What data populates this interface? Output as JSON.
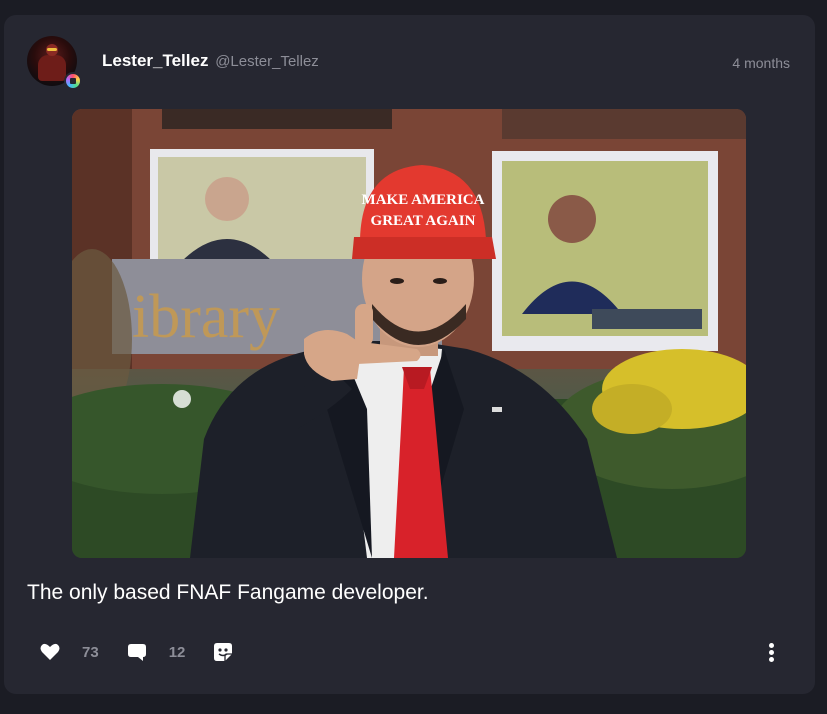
{
  "post": {
    "author": {
      "display_name": "Lester_Tellez",
      "handle": "@Lester_Tellez"
    },
    "timestamp": "4 months",
    "image": {
      "hat_line1": "MAKE AMERICA",
      "hat_line2": "GREAT AGAIN",
      "sign_text": "ibrary"
    },
    "text": "The only based FNAF Fangame developer.",
    "actions": {
      "likes": "73",
      "comments": "12"
    }
  },
  "colors": {
    "background": "#1b1c24",
    "card": "#262731",
    "muted_text": "#8d8e98",
    "hat_red": "#e3392f",
    "tie_red": "#d8222a"
  },
  "icons": {
    "like": "heart-icon",
    "comment": "comment-bubble-icon",
    "react": "emoji-sticker-icon",
    "more": "kebab-menu-icon",
    "badge": "verified-badge-icon"
  }
}
